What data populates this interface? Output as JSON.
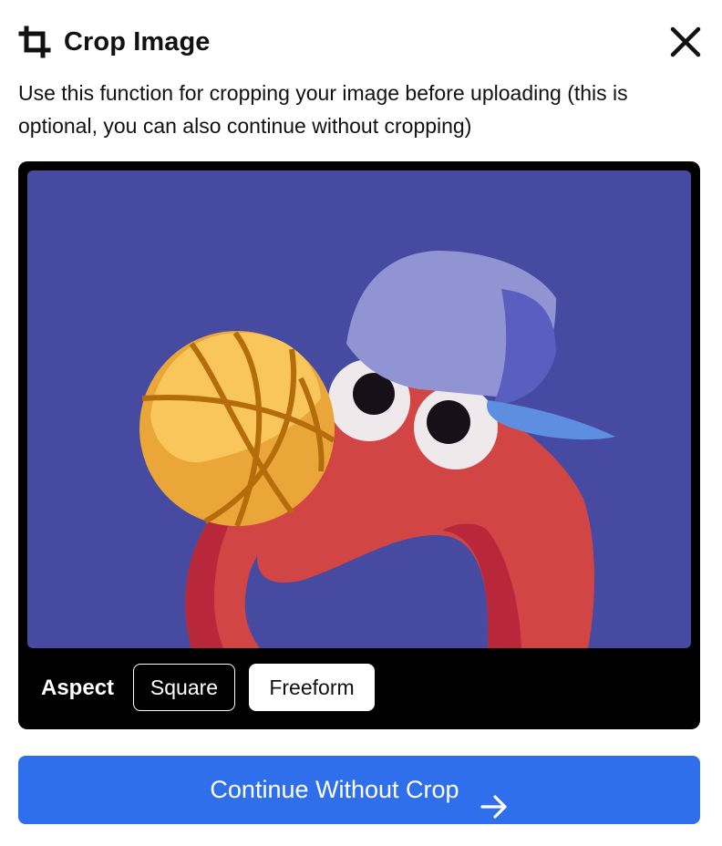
{
  "dialog": {
    "title": "Crop Image",
    "description": "Use this function for cropping your image before uploading (this is optional, you can also continue without cropping)",
    "icons": {
      "title_icon": "crop-icon",
      "close_icon": "close-icon",
      "continue_icon": "arrow-right-icon"
    }
  },
  "crop": {
    "aspect_label": "Aspect",
    "options": [
      "Square",
      "Freeform"
    ],
    "selected": "Freeform"
  },
  "actions": {
    "continue_label": "Continue Without Crop"
  },
  "colors": {
    "image_background": "#464aa0",
    "primary_button": "#2f6fec",
    "panel_background": "#000000"
  }
}
